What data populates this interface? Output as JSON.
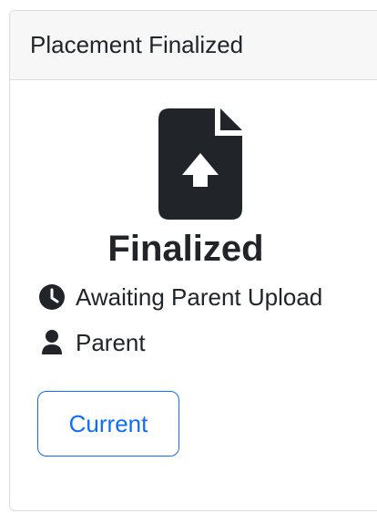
{
  "card": {
    "header_title": "Placement Finalized",
    "status_title": "Finalized",
    "status_line": "Awaiting Parent Upload",
    "assignee_line": "Parent",
    "action_label": "Current"
  },
  "icons": {
    "main": "file-upload-icon",
    "status": "clock-icon",
    "assignee": "user-icon"
  },
  "colors": {
    "primary": "#0d6efd",
    "text": "#212529",
    "header_bg": "#f7f7f7",
    "border": "#dcdcdc",
    "icon_dark": "#212529"
  }
}
